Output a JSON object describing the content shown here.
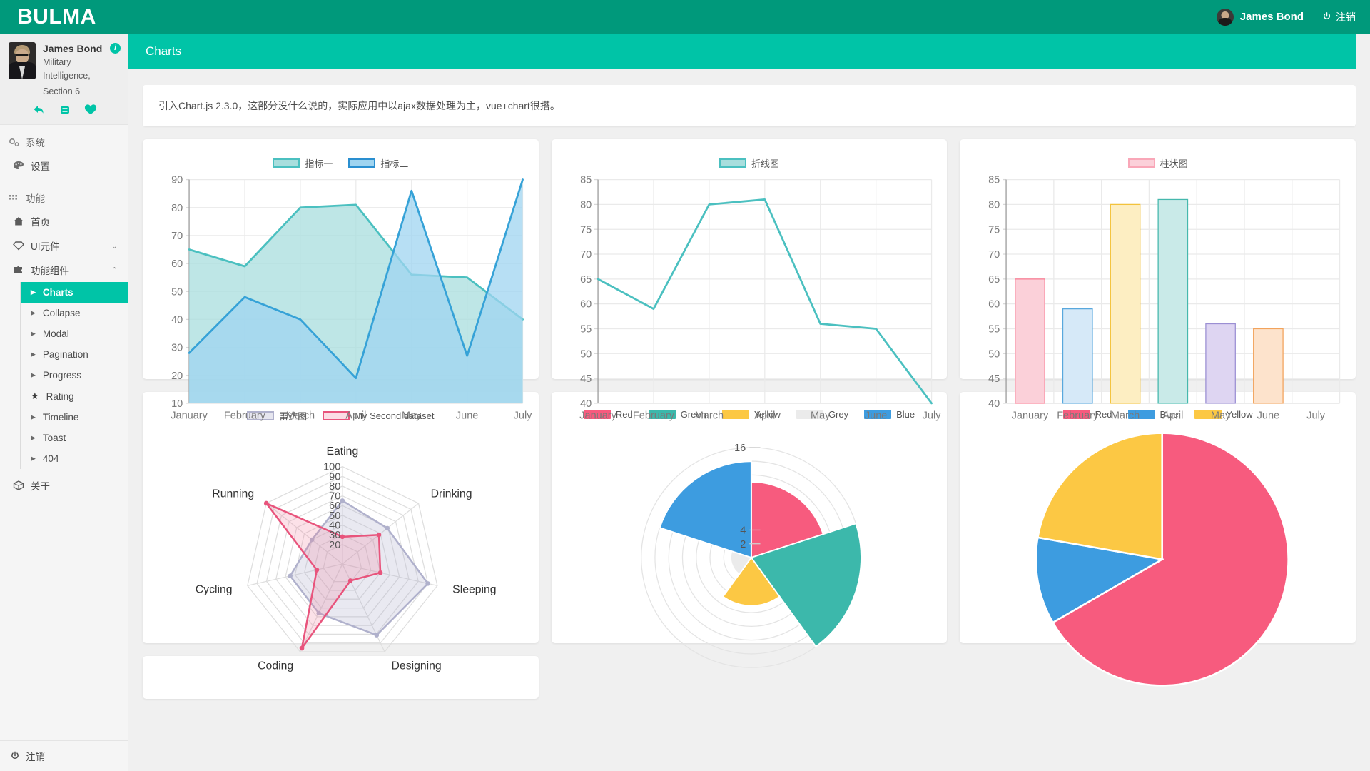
{
  "topnav": {
    "brand": "BULMA",
    "user_name": "James Bond",
    "logout_label": "注销",
    "avatar_icon": "user-avatar",
    "power_icon": "power-icon"
  },
  "sidebar": {
    "profile": {
      "name": "James Bond",
      "role_line1": "Military Intelligence,",
      "role_line2": "Section 6",
      "info_badge": "i",
      "actions": [
        "reply-icon",
        "retweet-icon",
        "heart-icon"
      ]
    },
    "groups": [
      {
        "label": "系统",
        "icon": "gears-icon",
        "items": [
          {
            "label": "设置",
            "icon": "palette-icon",
            "chev": "",
            "active": false
          }
        ]
      },
      {
        "label": "功能",
        "icon": "grid-icon",
        "items": [
          {
            "label": "首页",
            "icon": "home-icon",
            "chev": "",
            "active": false
          },
          {
            "label": "UI元件",
            "icon": "diamond-icon",
            "chev": "⌄",
            "active": false
          },
          {
            "label": "功能组件",
            "icon": "puzzle-icon",
            "chev": "⌃",
            "active": false
          }
        ]
      }
    ],
    "submenu": [
      {
        "label": "Charts",
        "icon": "triangle-right-icon",
        "active": true
      },
      {
        "label": "Collapse",
        "icon": "triangle-right-icon",
        "active": false
      },
      {
        "label": "Modal",
        "icon": "triangle-right-icon",
        "active": false
      },
      {
        "label": "Pagination",
        "icon": "triangle-right-icon",
        "active": false
      },
      {
        "label": "Progress",
        "icon": "triangle-right-icon",
        "active": false
      },
      {
        "label": "Rating",
        "icon": "star-icon",
        "active": false
      },
      {
        "label": "Timeline",
        "icon": "triangle-right-icon",
        "active": false
      },
      {
        "label": "Toast",
        "icon": "triangle-right-icon",
        "active": false
      },
      {
        "label": "404",
        "icon": "triangle-right-icon",
        "active": false
      }
    ],
    "about": {
      "label": "关于",
      "icon": "cube-icon"
    },
    "footer_logout": {
      "label": "注销",
      "icon": "power-icon"
    }
  },
  "page": {
    "title": "Charts",
    "notice": "引入Chart.js 2.3.0，这部分没什么说的，实际应用中以ajax数据处理为主，vue+chart很搭。"
  },
  "chart_data": [
    {
      "type": "area",
      "title": "",
      "categories": [
        "January",
        "February",
        "March",
        "April",
        "May",
        "June",
        "July"
      ],
      "series": [
        {
          "name": "指标一",
          "values": [
            65,
            59,
            80,
            81,
            56,
            55,
            40
          ],
          "color": "#4bc0c0",
          "fill": "#a8dedd"
        },
        {
          "name": "指标二",
          "values": [
            28,
            48,
            40,
            19,
            86,
            27,
            90
          ],
          "color": "#36a2d7",
          "fill": "#9fd4f0"
        }
      ],
      "ylim": [
        10,
        90
      ],
      "yticks": [
        10,
        20,
        30,
        40,
        50,
        60,
        70,
        80,
        90
      ],
      "grid": true,
      "legend_position": "top"
    },
    {
      "type": "line",
      "title": "",
      "categories": [
        "January",
        "February",
        "March",
        "April",
        "May",
        "June",
        "July"
      ],
      "series": [
        {
          "name": "折线图",
          "values": [
            65,
            59,
            80,
            81,
            56,
            55,
            40
          ],
          "color": "#4bc0c0",
          "fill": "#a8dedd"
        }
      ],
      "ylim": [
        40,
        85
      ],
      "yticks": [
        40,
        45,
        50,
        55,
        60,
        65,
        70,
        75,
        80,
        85
      ],
      "grid": true,
      "legend_position": "top"
    },
    {
      "type": "bar",
      "title": "",
      "categories": [
        "January",
        "February",
        "March",
        "April",
        "May",
        "June",
        "July"
      ],
      "series": [
        {
          "name": "柱状图",
          "values": [
            65,
            59,
            80,
            81,
            56,
            55,
            40
          ]
        }
      ],
      "bar_colors": [
        "#fbd0d9",
        "#d6e9f8",
        "#fdeec2",
        "#c9eae8",
        "#ded5f2",
        "#fde3cc",
        "#f5d0d0"
      ],
      "bar_borders": [
        "#f97b92",
        "#59a8dd",
        "#f3c23b",
        "#45b8ad",
        "#9b8fd3",
        "#f2a35c",
        "#e87b7b"
      ],
      "ylim": [
        40,
        85
      ],
      "yticks": [
        40,
        45,
        50,
        55,
        60,
        65,
        70,
        75,
        80,
        85
      ],
      "grid": true,
      "legend_position": "top",
      "legend_label": "柱状图",
      "legend_color": "#fbd0d9",
      "legend_border": "#f97b92"
    },
    {
      "type": "radar",
      "title": "",
      "categories": [
        "Eating",
        "Drinking",
        "Sleeping",
        "Designing",
        "Coding",
        "Cycling",
        "Running"
      ],
      "series": [
        {
          "name": "雷达图",
          "values": [
            65,
            59,
            90,
            81,
            56,
            55,
            40
          ],
          "color": "#b0b1cc",
          "fill": "rgba(176,177,204,0.28)"
        },
        {
          "name": "My Second dataset",
          "values": [
            28,
            48,
            40,
            19,
            96,
            27,
            100
          ],
          "color": "#e8547c",
          "fill": "rgba(240,120,150,0.22)"
        }
      ],
      "rticks": [
        20,
        30,
        40,
        50,
        60,
        70,
        80,
        90,
        100
      ],
      "rmax": 100,
      "grid": true,
      "legend_position": "top"
    },
    {
      "type": "polar",
      "title": "",
      "labels": [
        "Red",
        "Green",
        "Yellow",
        "Grey",
        "Blue"
      ],
      "values": [
        11,
        16,
        7,
        3,
        14
      ],
      "colors": [
        "#f75b7e",
        "#3cb8ab",
        "#fcc844",
        "#ebebeb",
        "#3d9ce0"
      ],
      "rticks": [
        2,
        4,
        16
      ],
      "rmax": 16,
      "grid": true,
      "legend_position": "top"
    },
    {
      "type": "pie",
      "title": "",
      "labels": [
        "Red",
        "Blue",
        "Yellow"
      ],
      "values": [
        300,
        50,
        100
      ],
      "colors": [
        "#f75b7e",
        "#3d9ce0",
        "#fcc844"
      ],
      "legend_position": "top"
    }
  ]
}
